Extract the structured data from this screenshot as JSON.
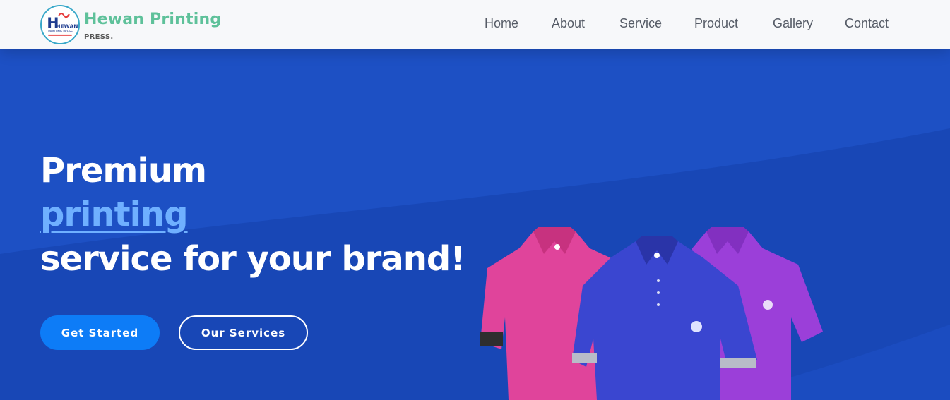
{
  "brand": {
    "name": "Hewan Printing",
    "subtitle": "PRESS.",
    "logo_text": "HEWAN",
    "logo_tagline": "PRINTING PRESS",
    "colors": {
      "name": "#5ec19a",
      "badge_ring": "#38a8c9"
    }
  },
  "nav": {
    "items": [
      {
        "label": "Home"
      },
      {
        "label": "About"
      },
      {
        "label": "Service"
      },
      {
        "label": "Product"
      },
      {
        "label": "Gallery"
      },
      {
        "label": "Contact"
      }
    ]
  },
  "hero": {
    "line1": "Premium",
    "line2": "printing",
    "line3": "service for your brand!",
    "cta_primary": "Get Started",
    "cta_secondary": "Our Services",
    "colors": {
      "background": "#1e52c8",
      "accent": "#6fb0ff",
      "primary_button": "#0d7cf7"
    },
    "image": "three polo shirts: pink, blue, purple"
  }
}
